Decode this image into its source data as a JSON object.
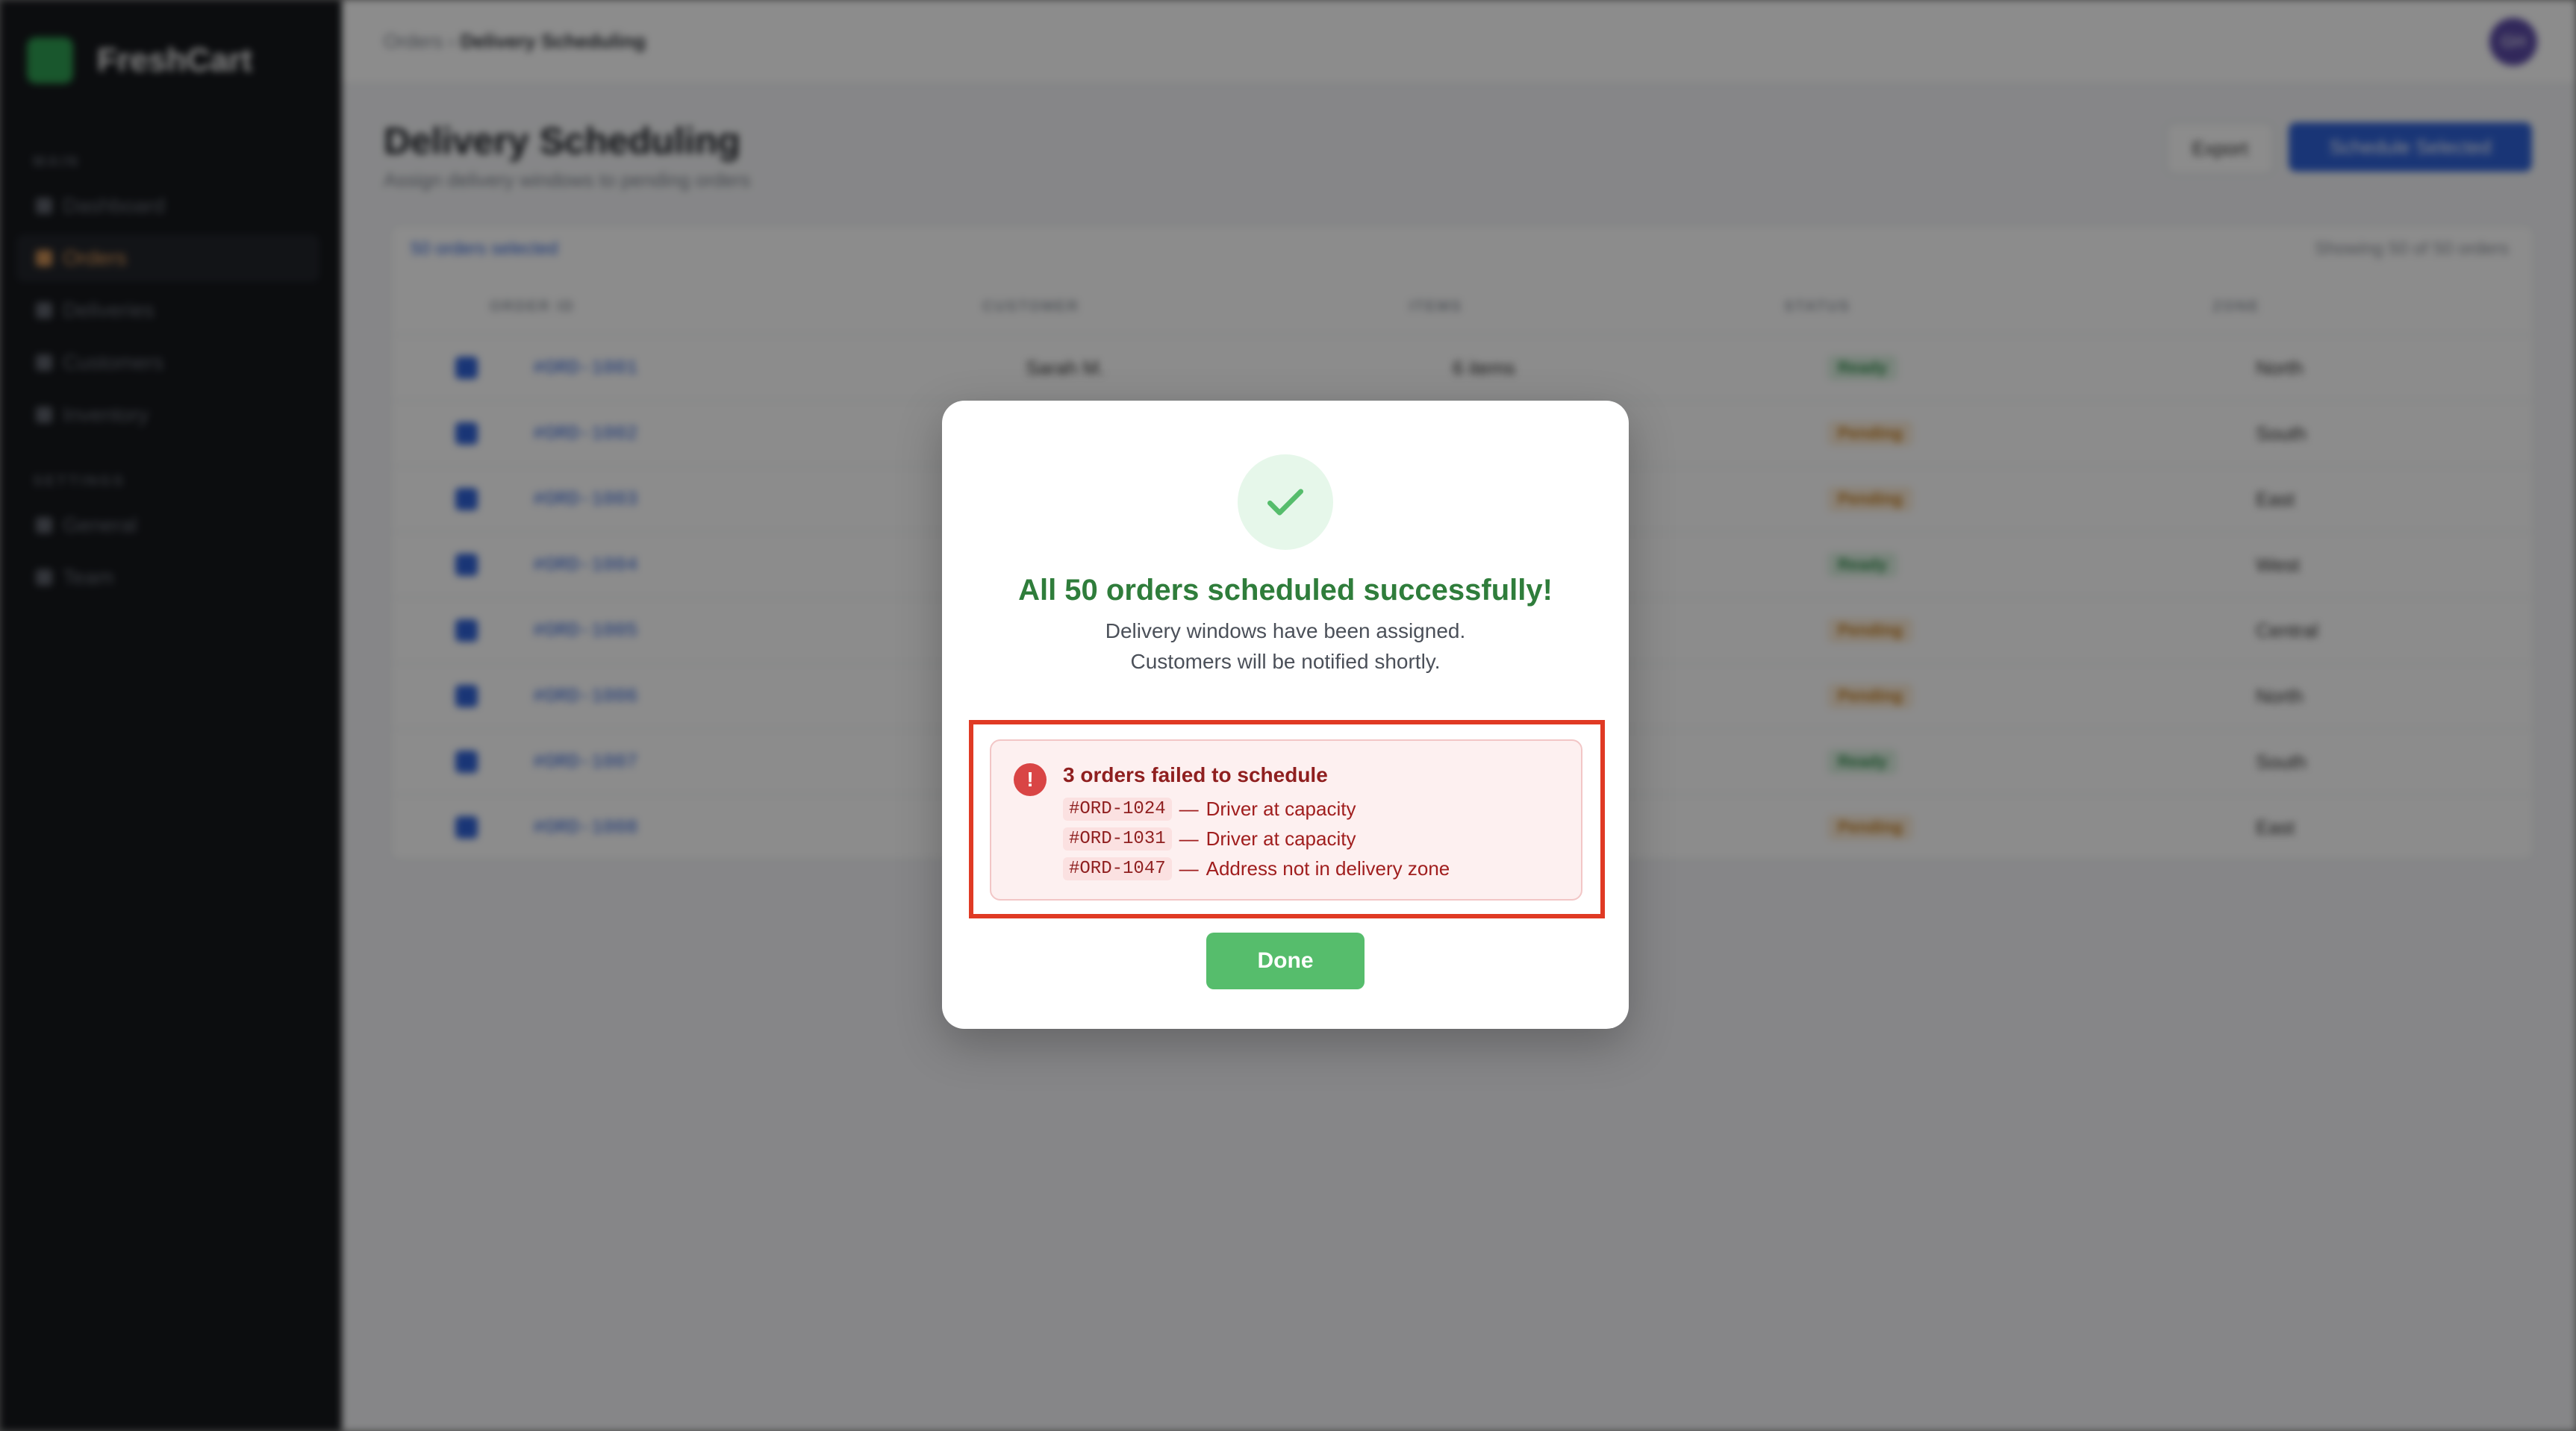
{
  "app": {
    "brand": "FreshCart"
  },
  "sidebar": {
    "sections": [
      {
        "title": "MAIN",
        "items": [
          {
            "label": "Dashboard",
            "active": false
          },
          {
            "label": "Orders",
            "active": true
          },
          {
            "label": "Deliveries",
            "active": false
          },
          {
            "label": "Customers",
            "active": false
          },
          {
            "label": "Inventory",
            "active": false
          }
        ]
      },
      {
        "title": "SETTINGS",
        "items": [
          {
            "label": "General",
            "active": false
          },
          {
            "label": "Team",
            "active": false
          }
        ]
      }
    ]
  },
  "header": {
    "breadcrumb_parent": "Orders",
    "breadcrumb_sep": " › ",
    "breadcrumb_current": "Delivery Scheduling",
    "avatar_initials": "GH"
  },
  "page": {
    "title": "Delivery Scheduling",
    "subtitle": "Assign delivery windows to pending orders",
    "export_label": "Export",
    "schedule_label": "Schedule Selected"
  },
  "table": {
    "selected_text": "50 orders selected",
    "showing_text": "Showing 50 of 50 orders",
    "headers": [
      "ORDER ID",
      "CUSTOMER",
      "ITEMS",
      "STATUS",
      "ZONE"
    ],
    "rows": [
      {
        "id": "#ORD-1001",
        "customer": "Sarah M.",
        "items": "6 items",
        "status": "Ready",
        "zone": "North"
      },
      {
        "id": "#ORD-1002",
        "customer": "",
        "items": "",
        "status": "Pending",
        "zone": "South"
      },
      {
        "id": "#ORD-1003",
        "customer": "",
        "items": "",
        "status": "Pending",
        "zone": "East"
      },
      {
        "id": "#ORD-1004",
        "customer": "",
        "items": "",
        "status": "Ready",
        "zone": "West"
      },
      {
        "id": "#ORD-1005",
        "customer": "",
        "items": "",
        "status": "Pending",
        "zone": "Central"
      },
      {
        "id": "#ORD-1006",
        "customer": "",
        "items": "",
        "status": "Pending",
        "zone": "North"
      },
      {
        "id": "#ORD-1007",
        "customer": "",
        "items": "",
        "status": "Ready",
        "zone": "South"
      },
      {
        "id": "#ORD-1008",
        "customer": "",
        "items": "",
        "status": "Pending",
        "zone": "East"
      }
    ]
  },
  "modal": {
    "title": "All 50 orders scheduled successfully!",
    "line1": "Delivery windows have been assigned.",
    "line2": "Customers will be notified shortly.",
    "error": {
      "icon": "!",
      "title": "3 orders failed to schedule",
      "separator": "—",
      "items": [
        {
          "code": "#ORD-1024",
          "reason": "Driver at capacity"
        },
        {
          "code": "#ORD-1031",
          "reason": "Driver at capacity"
        },
        {
          "code": "#ORD-1047",
          "reason": "Address not in delivery zone"
        }
      ]
    },
    "done_label": "Done"
  },
  "colors": {
    "success": "#2f7d3b",
    "done_button": "#56bd6c",
    "error_outline": "#e03a24",
    "primary": "#2f62d8"
  },
  "icons": {
    "success": "check-icon",
    "error": "alert-circle-icon"
  }
}
